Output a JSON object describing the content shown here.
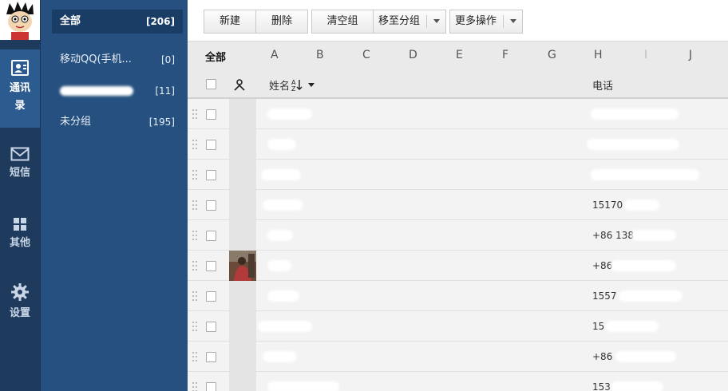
{
  "rail": {
    "items": [
      {
        "label": "通讯录",
        "icon": "contacts-icon",
        "active": true
      },
      {
        "label": "短信",
        "icon": "envelope-icon",
        "active": false
      },
      {
        "label": "其他",
        "icon": "grid-icon",
        "active": false
      },
      {
        "label": "设置",
        "icon": "gear-icon",
        "active": false
      }
    ]
  },
  "groups": [
    {
      "label": "全部",
      "count": "[206]",
      "active": true
    },
    {
      "label": "移动QQ(手机...",
      "count": "[0]",
      "active": false
    },
    {
      "label": "",
      "count": "[11]",
      "active": false,
      "redacted": true
    },
    {
      "label": "未分组",
      "count": "[195]",
      "active": false
    }
  ],
  "toolbar": {
    "new_label": "新建",
    "delete_label": "删除",
    "clear_label": "清空组",
    "move_label": "移至分组",
    "more_label": "更多操作"
  },
  "alpha": {
    "all": "全部",
    "letters": [
      "A",
      "B",
      "C",
      "D",
      "E",
      "F",
      "G",
      "H",
      "I",
      "J"
    ]
  },
  "table": {
    "name_header": "姓名",
    "phone_header": "电话",
    "rows": [
      {
        "name": "",
        "phone": "",
        "has_photo": false
      },
      {
        "name": "",
        "phone": "",
        "has_photo": false
      },
      {
        "name": "",
        "phone": "",
        "has_photo": false
      },
      {
        "name": "",
        "phone": "15170",
        "has_photo": false
      },
      {
        "name": "",
        "phone": "+86 138",
        "has_photo": false
      },
      {
        "name": "",
        "phone": "+86",
        "has_photo": true
      },
      {
        "name": "",
        "phone": "1557",
        "has_photo": false
      },
      {
        "name": "",
        "phone": "15",
        "has_photo": false
      },
      {
        "name": "",
        "phone": "+86",
        "has_photo": false
      },
      {
        "name": "",
        "phone": "153",
        "has_photo": false
      }
    ]
  },
  "colors": {
    "rail_bg": "#1e3a5c",
    "group_bg": "#25507f",
    "active_rail": "#2b5b8f"
  }
}
